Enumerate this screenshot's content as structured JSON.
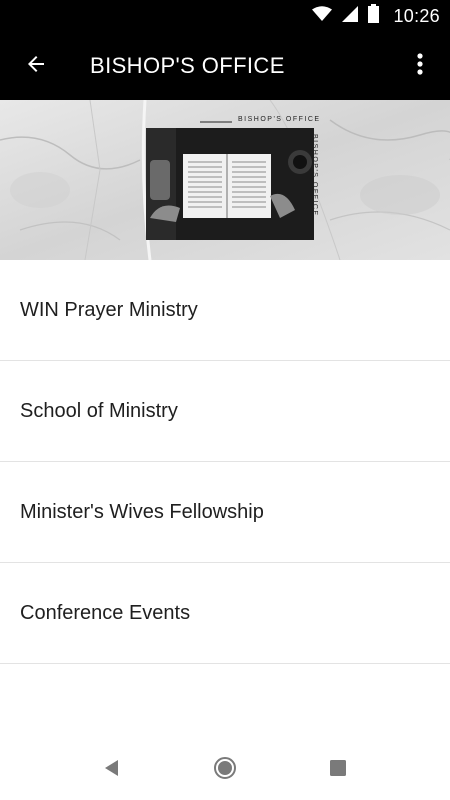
{
  "status_bar": {
    "time": "10:26",
    "icons": [
      "wifi-icon",
      "signal-icon",
      "battery-icon"
    ]
  },
  "app_bar": {
    "title": "BISHOP'S OFFICE",
    "back_icon": "arrow-left-icon",
    "menu_icon": "more-vert-icon"
  },
  "banner": {
    "caption_top": "BISHOP'S OFFICE",
    "caption_side": "BISHOP'S OFFICE"
  },
  "menu": {
    "items": [
      {
        "label": "WIN Prayer Ministry"
      },
      {
        "label": "School of Ministry"
      },
      {
        "label": "Minister's Wives Fellowship"
      },
      {
        "label": "Conference Events"
      }
    ]
  },
  "nav_bar": {
    "icons": [
      "back-triangle-icon",
      "home-circle-icon",
      "recents-square-icon"
    ]
  },
  "colors": {
    "app_bar_bg": "#000000",
    "text_primary": "#1f1f1f",
    "divider": "#e3e3e3"
  }
}
